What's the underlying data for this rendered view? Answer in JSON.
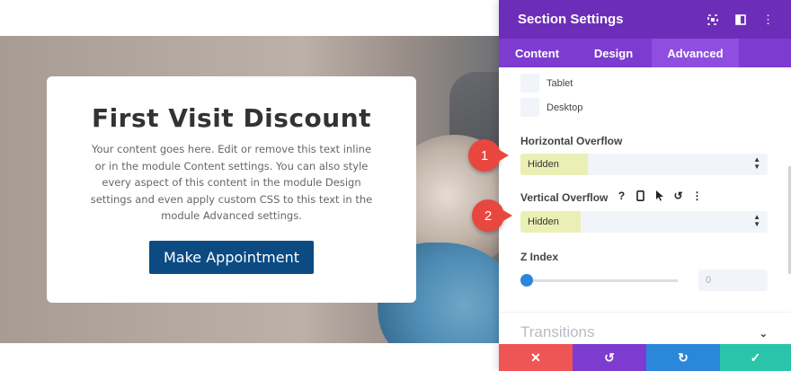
{
  "preview": {
    "card": {
      "title": "First Visit Discount",
      "body": "Your content goes here. Edit or remove this text inline or in the module Content settings. You can also style every aspect of this content in the module Design settings and even apply custom CSS to this text in the module Advanced settings.",
      "button_label": "Make Appointment"
    }
  },
  "panel": {
    "title": "Section Settings",
    "header_icons": [
      "expand-icon",
      "columns-icon",
      "more-vertical-icon"
    ],
    "tabs": [
      {
        "label": "Content"
      },
      {
        "label": "Design"
      },
      {
        "label": "Advanced",
        "active": true
      }
    ],
    "visibility": [
      {
        "label": "Tablet",
        "checked": false
      },
      {
        "label": "Desktop",
        "checked": false
      }
    ],
    "horizontal_overflow": {
      "label": "Horizontal Overflow",
      "value": "Hidden"
    },
    "vertical_overflow": {
      "label": "Vertical Overflow",
      "value": "Hidden",
      "option_icons": [
        "help-icon",
        "phone-icon",
        "cursor-icon",
        "reset-icon",
        "more-vertical-icon"
      ]
    },
    "z_index": {
      "label": "Z Index",
      "value": "0",
      "placeholder": "0",
      "slider_level": 0
    },
    "next_section": "Transitions",
    "footer": [
      "close-icon",
      "undo-icon",
      "redo-icon",
      "check-icon"
    ]
  },
  "callouts": [
    "1",
    "2"
  ],
  "colors": {
    "header": "#6c2eb9",
    "tabs": "#7e3bd0",
    "highlight": "#eaf0b5",
    "callout": "#e8473f",
    "cancel": "#ef5555",
    "undo": "#7e3bd0",
    "redo": "#2b87da",
    "save": "#29c4a9",
    "cta": "#0c4a82"
  }
}
